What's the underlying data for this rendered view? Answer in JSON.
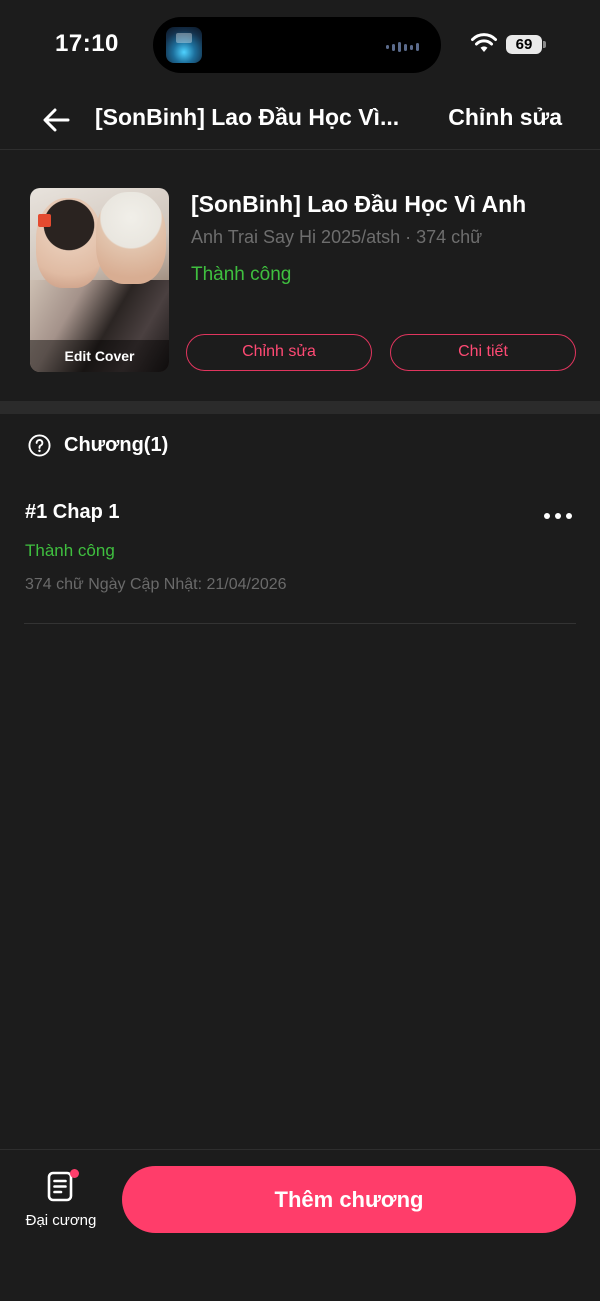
{
  "status_bar": {
    "time": "17:10",
    "battery": "69"
  },
  "header": {
    "title": "[SonBinh] Lao Đầu Học Vì...",
    "edit_label": "Chỉnh sửa"
  },
  "book": {
    "cover_caption": "Edit Cover",
    "title": "[SonBinh] Lao Đầu Học Vì Anh",
    "meta": "Anh Trai Say Hi 2025/atsh · 374 chữ",
    "status": "Thành công",
    "edit_button": "Chỉnh sửa",
    "detail_button": "Chi tiết"
  },
  "chapters": {
    "heading": "Chương(1)",
    "items": [
      {
        "title": "#1 Chap 1",
        "status": "Thành công",
        "meta": "374 chữ Ngày Cập Nhật: 21/04/2026"
      }
    ]
  },
  "bottom": {
    "outline_label": "Đại cương",
    "add_button": "Thêm chương"
  },
  "colors": {
    "accent": "#ff3d6a",
    "success": "#3fbf3f",
    "background": "#1c1c1c"
  }
}
